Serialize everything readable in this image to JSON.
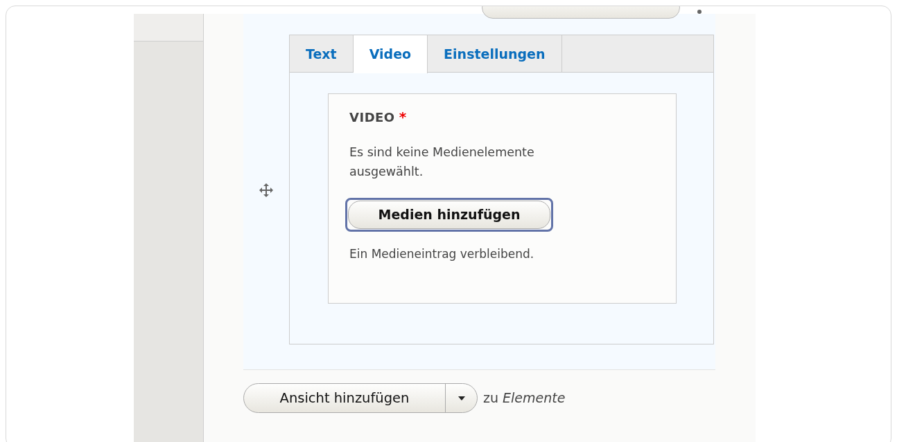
{
  "tabs": [
    {
      "label": "Text",
      "selected": false
    },
    {
      "label": "Video",
      "selected": true
    },
    {
      "label": "Einstellungen",
      "selected": false
    }
  ],
  "field": {
    "label": "VIDEO",
    "required_mark": "*",
    "message": "Es sind keine Medienelemente ausgewählt.",
    "button": {
      "label": "Medien hinzufügen",
      "focused": true
    },
    "remaining": "Ein Medieneintrag verbleibend."
  },
  "add_view": {
    "button": "Ansicht hinzufügen",
    "suffix": "zu *Elemente*"
  }
}
